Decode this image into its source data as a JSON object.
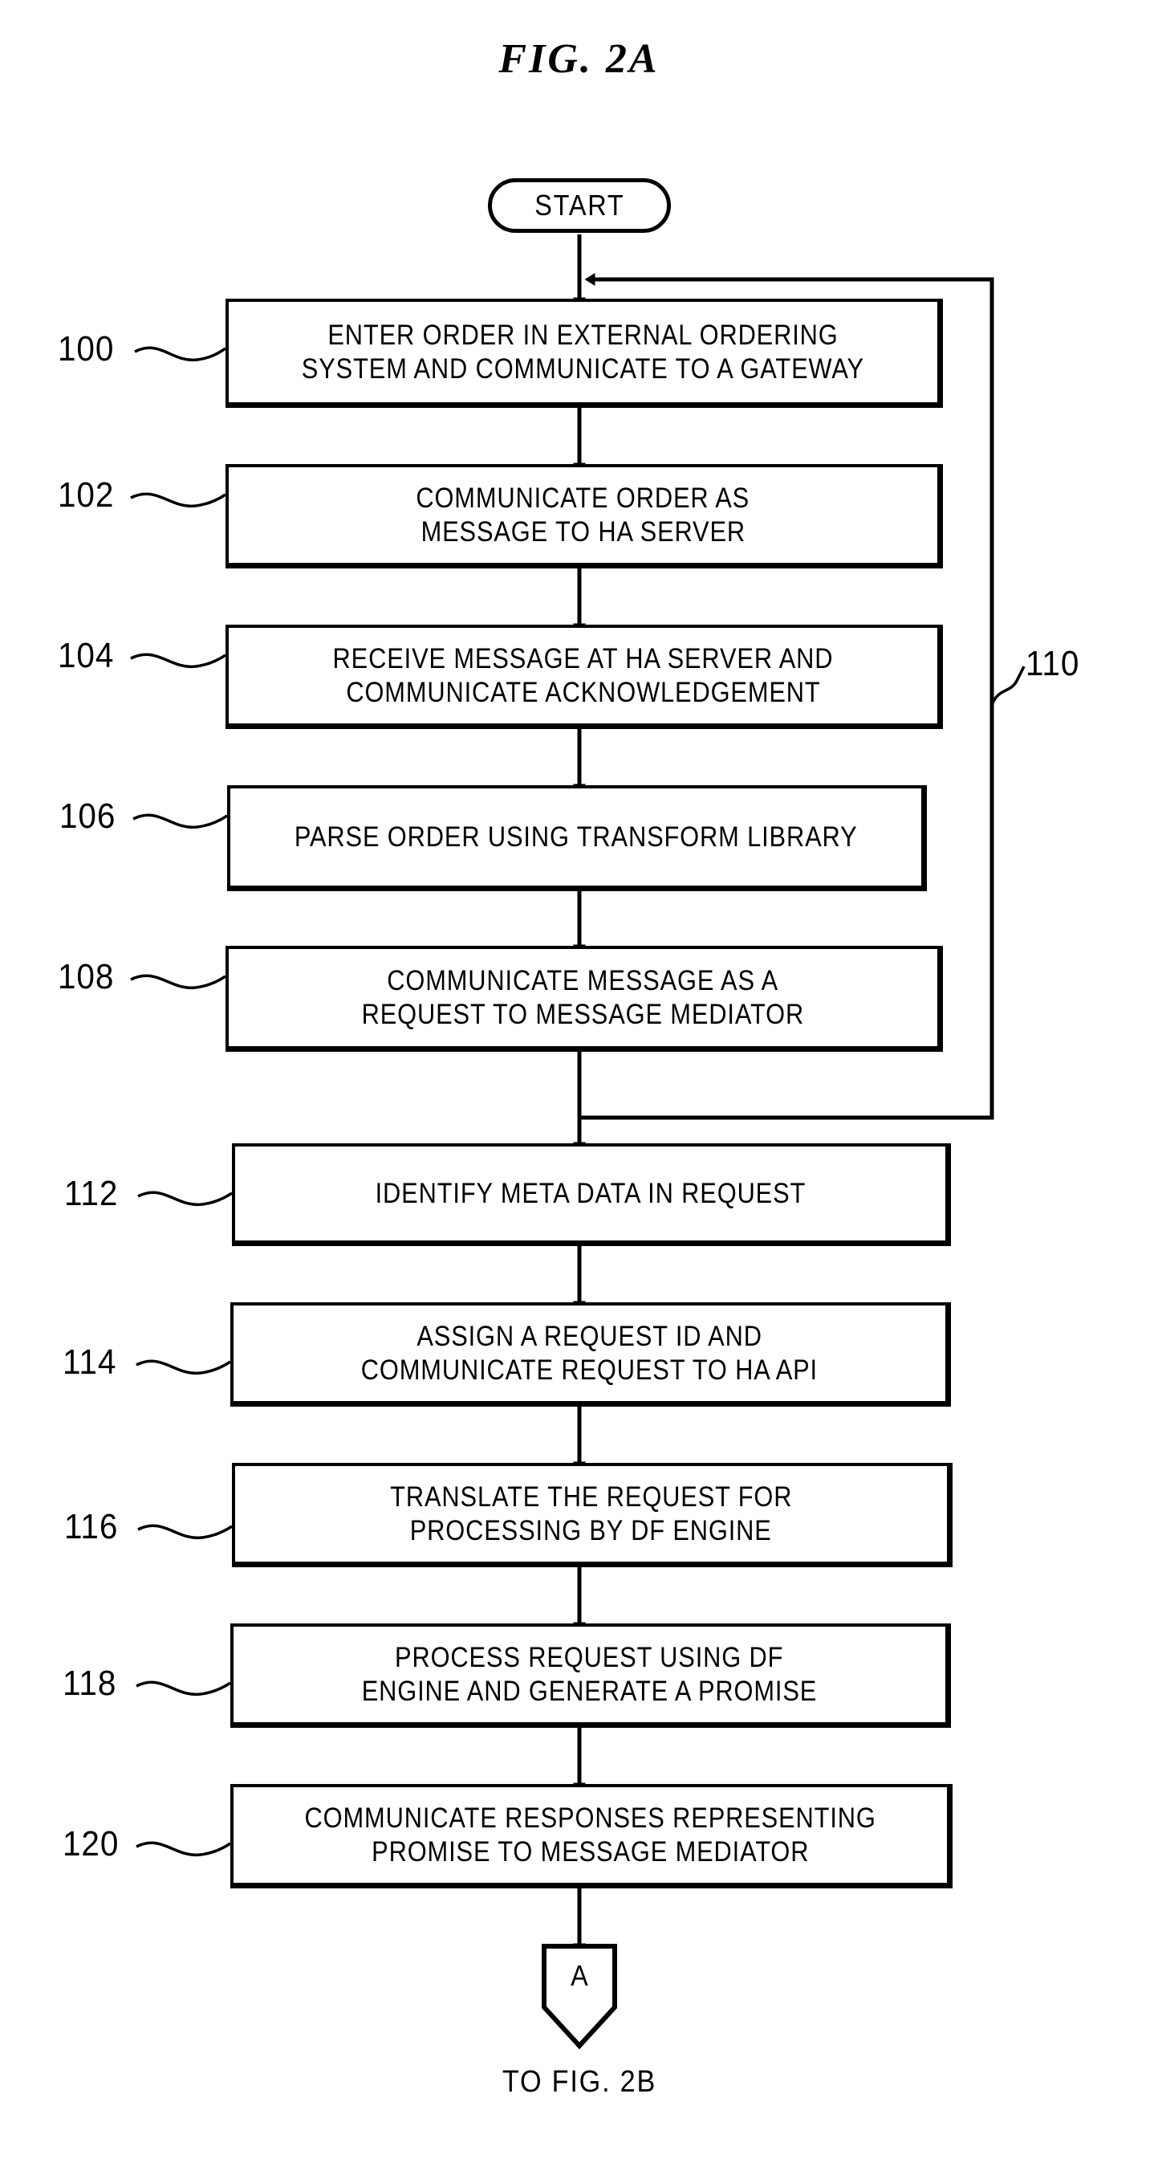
{
  "figure": {
    "title": "FIG. 2A",
    "start_label": "START",
    "loop_ref": "110",
    "connector_letter": "A",
    "goto_label": "TO FIG. 2B"
  },
  "steps": [
    {
      "ref": "100",
      "lines": [
        "ENTER ORDER IN EXTERNAL ORDERING",
        "SYSTEM AND COMMUNICATE TO A GATEWAY"
      ]
    },
    {
      "ref": "102",
      "lines": [
        "COMMUNICATE ORDER AS",
        "MESSAGE TO HA SERVER"
      ]
    },
    {
      "ref": "104",
      "lines": [
        "RECEIVE MESSAGE AT HA SERVER AND",
        "COMMUNICATE ACKNOWLEDGEMENT"
      ]
    },
    {
      "ref": "106",
      "lines": [
        "PARSE ORDER USING TRANSFORM LIBRARY"
      ]
    },
    {
      "ref": "108",
      "lines": [
        "COMMUNICATE MESSAGE AS A",
        "REQUEST TO MESSAGE MEDIATOR"
      ]
    },
    {
      "ref": "112",
      "lines": [
        "IDENTIFY META DATA IN REQUEST"
      ]
    },
    {
      "ref": "114",
      "lines": [
        "ASSIGN A REQUEST ID AND",
        "COMMUNICATE REQUEST TO HA API"
      ]
    },
    {
      "ref": "116",
      "lines": [
        "TRANSLATE THE REQUEST FOR",
        "PROCESSING BY DF ENGINE"
      ]
    },
    {
      "ref": "118",
      "lines": [
        "PROCESS REQUEST USING DF",
        "ENGINE AND GENERATE A PROMISE"
      ]
    },
    {
      "ref": "120",
      "lines": [
        "COMMUNICATE RESPONSES REPRESENTING",
        "PROMISE TO MESSAGE MEDIATOR"
      ]
    }
  ],
  "colors": {
    "ink": "#000000",
    "paper": "#ffffff"
  }
}
